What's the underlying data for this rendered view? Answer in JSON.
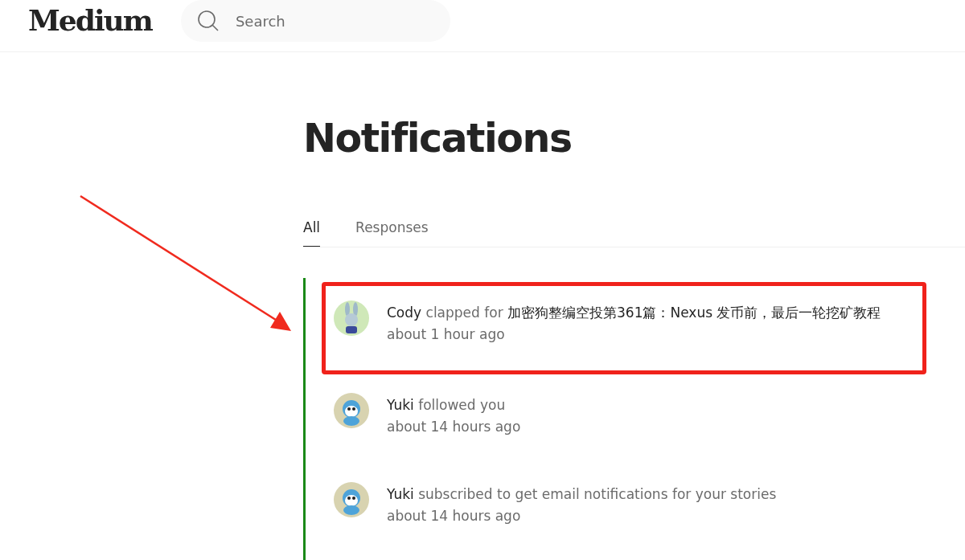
{
  "header": {
    "logo": "Medium",
    "search": {
      "placeholder": "Search"
    }
  },
  "title": "Notifications",
  "tabs": [
    {
      "label": "All",
      "selected": true
    },
    {
      "label": "Responses",
      "selected": false
    }
  ],
  "notifications": [
    {
      "actor": "Cody",
      "action": "clapped for",
      "target": "加密狗整编空投第361篇：Nexus 发币前，最后一轮挖矿教程",
      "time": "about 1 hour ago",
      "kind": "rabbit",
      "marked": true
    },
    {
      "actor": "Yuki",
      "action": "followed you",
      "time": "about 14 hours ago",
      "kind": "bird",
      "marked": false
    },
    {
      "actor": "Yuki",
      "action": "subscribed to get email notifications for your stories",
      "time": "about 14 hours ago",
      "kind": "bird",
      "marked": false
    }
  ]
}
